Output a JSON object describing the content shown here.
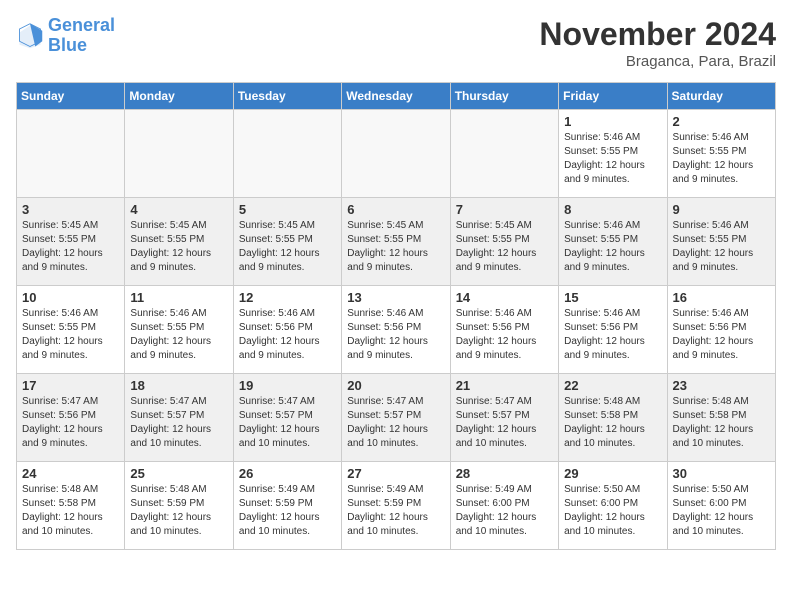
{
  "header": {
    "logo_line1": "General",
    "logo_line2": "Blue",
    "month": "November 2024",
    "location": "Braganca, Para, Brazil"
  },
  "weekdays": [
    "Sunday",
    "Monday",
    "Tuesday",
    "Wednesday",
    "Thursday",
    "Friday",
    "Saturday"
  ],
  "weeks": [
    [
      {
        "day": "",
        "info": ""
      },
      {
        "day": "",
        "info": ""
      },
      {
        "day": "",
        "info": ""
      },
      {
        "day": "",
        "info": ""
      },
      {
        "day": "",
        "info": ""
      },
      {
        "day": "1",
        "info": "Sunrise: 5:46 AM\nSunset: 5:55 PM\nDaylight: 12 hours and 9 minutes."
      },
      {
        "day": "2",
        "info": "Sunrise: 5:46 AM\nSunset: 5:55 PM\nDaylight: 12 hours and 9 minutes."
      }
    ],
    [
      {
        "day": "3",
        "info": "Sunrise: 5:45 AM\nSunset: 5:55 PM\nDaylight: 12 hours and 9 minutes."
      },
      {
        "day": "4",
        "info": "Sunrise: 5:45 AM\nSunset: 5:55 PM\nDaylight: 12 hours and 9 minutes."
      },
      {
        "day": "5",
        "info": "Sunrise: 5:45 AM\nSunset: 5:55 PM\nDaylight: 12 hours and 9 minutes."
      },
      {
        "day": "6",
        "info": "Sunrise: 5:45 AM\nSunset: 5:55 PM\nDaylight: 12 hours and 9 minutes."
      },
      {
        "day": "7",
        "info": "Sunrise: 5:45 AM\nSunset: 5:55 PM\nDaylight: 12 hours and 9 minutes."
      },
      {
        "day": "8",
        "info": "Sunrise: 5:46 AM\nSunset: 5:55 PM\nDaylight: 12 hours and 9 minutes."
      },
      {
        "day": "9",
        "info": "Sunrise: 5:46 AM\nSunset: 5:55 PM\nDaylight: 12 hours and 9 minutes."
      }
    ],
    [
      {
        "day": "10",
        "info": "Sunrise: 5:46 AM\nSunset: 5:55 PM\nDaylight: 12 hours and 9 minutes."
      },
      {
        "day": "11",
        "info": "Sunrise: 5:46 AM\nSunset: 5:55 PM\nDaylight: 12 hours and 9 minutes."
      },
      {
        "day": "12",
        "info": "Sunrise: 5:46 AM\nSunset: 5:56 PM\nDaylight: 12 hours and 9 minutes."
      },
      {
        "day": "13",
        "info": "Sunrise: 5:46 AM\nSunset: 5:56 PM\nDaylight: 12 hours and 9 minutes."
      },
      {
        "day": "14",
        "info": "Sunrise: 5:46 AM\nSunset: 5:56 PM\nDaylight: 12 hours and 9 minutes."
      },
      {
        "day": "15",
        "info": "Sunrise: 5:46 AM\nSunset: 5:56 PM\nDaylight: 12 hours and 9 minutes."
      },
      {
        "day": "16",
        "info": "Sunrise: 5:46 AM\nSunset: 5:56 PM\nDaylight: 12 hours and 9 minutes."
      }
    ],
    [
      {
        "day": "17",
        "info": "Sunrise: 5:47 AM\nSunset: 5:56 PM\nDaylight: 12 hours and 9 minutes."
      },
      {
        "day": "18",
        "info": "Sunrise: 5:47 AM\nSunset: 5:57 PM\nDaylight: 12 hours and 10 minutes."
      },
      {
        "day": "19",
        "info": "Sunrise: 5:47 AM\nSunset: 5:57 PM\nDaylight: 12 hours and 10 minutes."
      },
      {
        "day": "20",
        "info": "Sunrise: 5:47 AM\nSunset: 5:57 PM\nDaylight: 12 hours and 10 minutes."
      },
      {
        "day": "21",
        "info": "Sunrise: 5:47 AM\nSunset: 5:57 PM\nDaylight: 12 hours and 10 minutes."
      },
      {
        "day": "22",
        "info": "Sunrise: 5:48 AM\nSunset: 5:58 PM\nDaylight: 12 hours and 10 minutes."
      },
      {
        "day": "23",
        "info": "Sunrise: 5:48 AM\nSunset: 5:58 PM\nDaylight: 12 hours and 10 minutes."
      }
    ],
    [
      {
        "day": "24",
        "info": "Sunrise: 5:48 AM\nSunset: 5:58 PM\nDaylight: 12 hours and 10 minutes."
      },
      {
        "day": "25",
        "info": "Sunrise: 5:48 AM\nSunset: 5:59 PM\nDaylight: 12 hours and 10 minutes."
      },
      {
        "day": "26",
        "info": "Sunrise: 5:49 AM\nSunset: 5:59 PM\nDaylight: 12 hours and 10 minutes."
      },
      {
        "day": "27",
        "info": "Sunrise: 5:49 AM\nSunset: 5:59 PM\nDaylight: 12 hours and 10 minutes."
      },
      {
        "day": "28",
        "info": "Sunrise: 5:49 AM\nSunset: 6:00 PM\nDaylight: 12 hours and 10 minutes."
      },
      {
        "day": "29",
        "info": "Sunrise: 5:50 AM\nSunset: 6:00 PM\nDaylight: 12 hours and 10 minutes."
      },
      {
        "day": "30",
        "info": "Sunrise: 5:50 AM\nSunset: 6:00 PM\nDaylight: 12 hours and 10 minutes."
      }
    ]
  ]
}
